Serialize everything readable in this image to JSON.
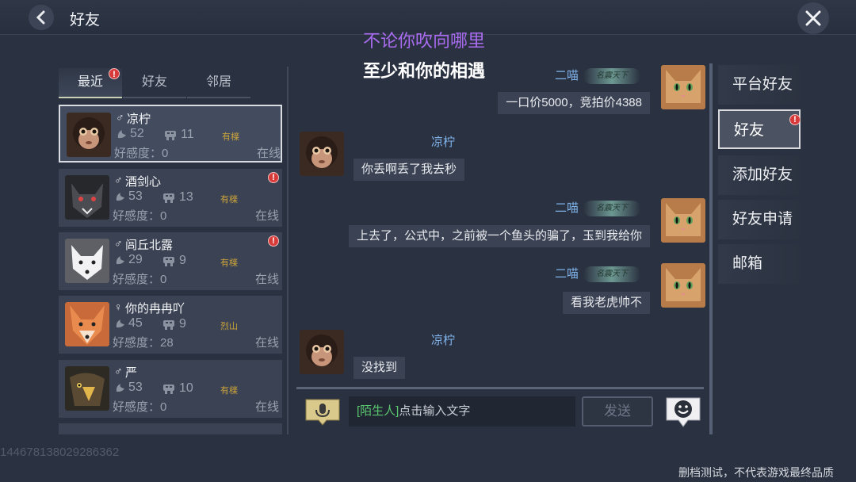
{
  "header": {
    "title": "好友"
  },
  "lyrics": {
    "line1": "不论你吹向哪里",
    "line2": "至少和你的相遇"
  },
  "tabs": [
    {
      "label": "最近",
      "active": true,
      "badge": "!"
    },
    {
      "label": "好友",
      "active": false
    },
    {
      "label": "邻居",
      "active": false
    }
  ],
  "friends": [
    {
      "gender": "♂",
      "name": "凉柠",
      "level": "52",
      "mobs": "11",
      "place": "有檪",
      "favor": "好感度：0",
      "status": "在线",
      "avatar": "monkey",
      "badge": ""
    },
    {
      "gender": "♂",
      "name": "酒剑心",
      "level": "53",
      "mobs": "13",
      "place": "有檪",
      "favor": "好感度：0",
      "status": "在线",
      "avatar": "wolf",
      "badge": "!"
    },
    {
      "gender": "♂",
      "name": "闾丘北露",
      "level": "29",
      "mobs": "9",
      "place": "有檪",
      "favor": "好感度：0",
      "status": "在线",
      "avatar": "white-fox",
      "badge": "!"
    },
    {
      "gender": "♀",
      "name": "你的冉冉吖",
      "level": "45",
      "mobs": "9",
      "place": "烈山",
      "favor": "好感度：28",
      "status": "在线",
      "avatar": "fox",
      "badge": ""
    },
    {
      "gender": "♂",
      "name": "严",
      "level": "53",
      "mobs": "10",
      "place": "有檪",
      "favor": "好感度：0",
      "status": "在线",
      "avatar": "eagle",
      "badge": ""
    }
  ],
  "messages": [
    {
      "side": "right",
      "name": "二喵",
      "title": "名震天下",
      "text": "一口价5000，竞拍价4388",
      "avatar": "cat"
    },
    {
      "side": "left",
      "name": "凉柠",
      "text": "你丢啊丢了我去秒",
      "avatar": "monkey"
    },
    {
      "side": "right",
      "name": "二喵",
      "title": "名震天下",
      "text": "上去了，公式中，之前被一个鱼头的骗了，玉到我给你",
      "avatar": "cat"
    },
    {
      "side": "right",
      "name": "二喵",
      "title": "名震天下",
      "text": "看我老虎帅不",
      "avatar": "cat"
    },
    {
      "side": "left",
      "name": "凉柠",
      "text": "没找到",
      "avatar": "monkey"
    }
  ],
  "input": {
    "tag": "[陌生人]",
    "placeholder": "点击输入文字",
    "send_label": "发送"
  },
  "side_menu": [
    {
      "label": "平台好友",
      "active": false
    },
    {
      "label": "好友",
      "active": true,
      "badge": "!"
    },
    {
      "label": "添加好友",
      "active": false
    },
    {
      "label": "好友申请",
      "active": false
    },
    {
      "label": "邮箱",
      "active": false
    }
  ],
  "footer": {
    "uid": "1446781380292863​62",
    "note": "删档测试，不代表游戏最终品质"
  },
  "colors": {
    "background": "#2a3140",
    "name_blue": "#7fb3ea",
    "lyric_purple": "#a96cf0",
    "badge_red": "#d83a3a",
    "place_gold": "#c9a23a"
  }
}
